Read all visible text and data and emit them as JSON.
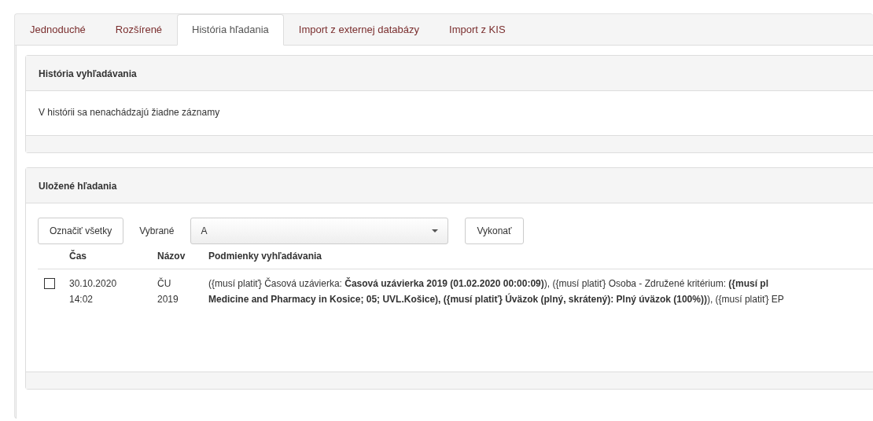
{
  "tabs": [
    {
      "label": "Jednoduché",
      "selected": false
    },
    {
      "label": "Rozšírené",
      "selected": false
    },
    {
      "label": "História hľadania",
      "selected": true
    },
    {
      "label": "Import z externej databázy",
      "selected": false
    },
    {
      "label": "Import z KIS",
      "selected": false
    }
  ],
  "history_panel": {
    "title": "História vyhľadávania",
    "message": "V histórii sa nenachádzajú žiadne záznamy"
  },
  "saved_panel": {
    "title": "Uložené hľadania",
    "toolbar": {
      "select_all_button": "Označiť všetky",
      "selected_label": "Vybrané",
      "action_select": "A",
      "execute_button": "Vykonať"
    },
    "columns": [
      "Čas",
      "Názov",
      "Podmienky vyhľadávania"
    ],
    "rows": [
      {
        "checked": false,
        "time": [
          "30.10.2020",
          "14:02"
        ],
        "name": [
          "ČU",
          "2019"
        ],
        "conditions": [
          "({musí platiť} Časová uzávierka: **Časová uzávierka 2019 (01.02.2020 00:00:09)**), ({musí platiť} Osoba - Združené kritérium: **({musí pl**",
          "**Medicine and Pharmacy in Kosice; 05; UVL.Košice), ({musí platiť} Úväzok (plný, skrátený): Plný úväzok (100%))**), ({musí platiť} EP"
        ]
      }
    ]
  }
}
